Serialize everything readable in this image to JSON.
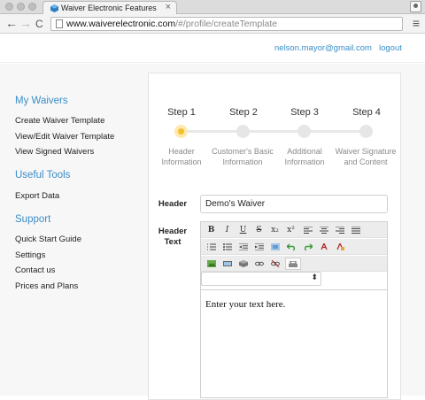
{
  "browser": {
    "tab_title": "Waiver Electronic Features",
    "tab_close": "×",
    "url_host": "www.waiverelectronic.com",
    "url_path": "/#/profile/createTemplate",
    "back_glyph": "←",
    "forward_glyph": "→",
    "reload_glyph": "C",
    "menu_glyph": "≡"
  },
  "header": {
    "email": "nelson.mayor@gmail.com",
    "logout": "logout"
  },
  "sidebar": {
    "my_waivers": {
      "title": "My Waivers",
      "items": [
        "Create Waiver Template",
        "View/Edit Waiver Template",
        "View Signed Waivers"
      ]
    },
    "useful_tools": {
      "title": "Useful Tools",
      "items": [
        "Export Data"
      ]
    },
    "support": {
      "title": "Support",
      "items": [
        "Quick Start Guide",
        "Settings",
        "Contact us",
        "Prices and Plans"
      ]
    }
  },
  "steps": [
    {
      "label": "Step 1",
      "desc1": "Header",
      "desc2": "Information",
      "active": true
    },
    {
      "label": "Step 2",
      "desc1": "Customer's Basic",
      "desc2": "Information",
      "active": false
    },
    {
      "label": "Step 3",
      "desc1": "Additional",
      "desc2": "Information",
      "active": false
    },
    {
      "label": "Step 4",
      "desc1": "Waiver Signature",
      "desc2": "and Content",
      "active": false
    }
  ],
  "form": {
    "header_label": "Header",
    "header_value": "Demo's Waiver",
    "header_text_label_1": "Header",
    "header_text_label_2": "Text",
    "editor_placeholder": "Enter your text here.",
    "format_select_value": ""
  },
  "editor_toolbar": {
    "bold": "B",
    "italic": "I",
    "underline": "U",
    "strikethrough": "S",
    "subscript": "x₂",
    "superscript": "x²"
  },
  "colors": {
    "accent": "#3a8dc8",
    "step_active": "#f3bd2c"
  }
}
